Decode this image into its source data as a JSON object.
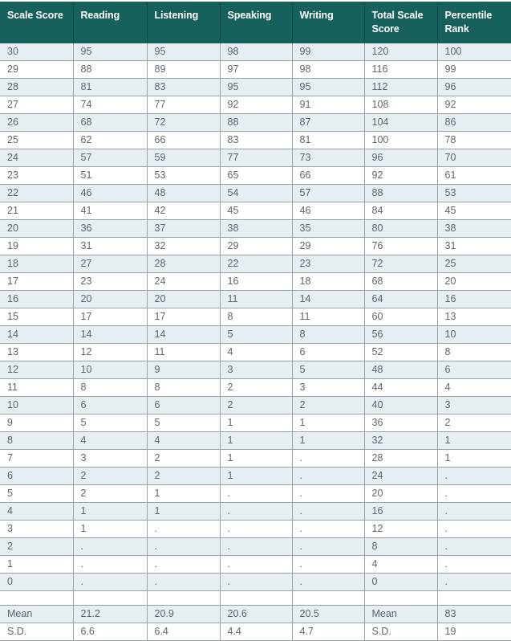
{
  "table": {
    "columns": [
      "Scale Score",
      "Reading",
      "Listening",
      "Speaking",
      "Writing",
      "Total Scale Score",
      "Percentile Rank"
    ],
    "rows": [
      [
        "30",
        "95",
        "95",
        "98",
        "99",
        "120",
        "100"
      ],
      [
        "29",
        "88",
        "89",
        "97",
        "98",
        "116",
        "99"
      ],
      [
        "28",
        "81",
        "83",
        "95",
        "95",
        "112",
        "96"
      ],
      [
        "27",
        "74",
        "77",
        "92",
        "91",
        "108",
        "92"
      ],
      [
        "26",
        "68",
        "72",
        "88",
        "87",
        "104",
        "86"
      ],
      [
        "25",
        "62",
        "66",
        "83",
        "81",
        "100",
        "78"
      ],
      [
        "24",
        "57",
        "59",
        "77",
        "73",
        "96",
        "70"
      ],
      [
        "23",
        "51",
        "53",
        "65",
        "66",
        "92",
        "61"
      ],
      [
        "22",
        "46",
        "48",
        "54",
        "57",
        "88",
        "53"
      ],
      [
        "21",
        "41",
        "42",
        "45",
        "46",
        "84",
        "45"
      ],
      [
        "20",
        "36",
        "37",
        "38",
        "35",
        "80",
        "38"
      ],
      [
        "19",
        "31",
        "32",
        "29",
        "29",
        "76",
        "31"
      ],
      [
        "18",
        "27",
        "28",
        "22",
        "23",
        "72",
        "25"
      ],
      [
        "17",
        "23",
        "24",
        "16",
        "18",
        "68",
        "20"
      ],
      [
        "16",
        "20",
        "20",
        "11",
        "14",
        "64",
        "16"
      ],
      [
        "15",
        "17",
        "17",
        "8",
        "11",
        "60",
        "13"
      ],
      [
        "14",
        "14",
        "14",
        "5",
        "8",
        "56",
        "10"
      ],
      [
        "13",
        "12",
        "11",
        "4",
        "6",
        "52",
        "8"
      ],
      [
        "12",
        "10",
        "9",
        "3",
        "5",
        "48",
        "6"
      ],
      [
        "11",
        "8",
        "8",
        "2",
        "3",
        "44",
        "4"
      ],
      [
        "10",
        "6",
        "6",
        "2",
        "2",
        "40",
        "3"
      ],
      [
        "9",
        "5",
        "5",
        "1",
        "1",
        "36",
        "2"
      ],
      [
        "8",
        "4",
        "4",
        "1",
        "1",
        "32",
        "1"
      ],
      [
        "7",
        "3",
        "2",
        "1",
        ".",
        "28",
        "1"
      ],
      [
        "6",
        "2",
        "2",
        "1",
        ".",
        "24",
        "."
      ],
      [
        "5",
        "2",
        "1",
        ".",
        ".",
        "20",
        "."
      ],
      [
        "4",
        "1",
        "1",
        ".",
        ".",
        "16",
        "."
      ],
      [
        "3",
        "1",
        ".",
        ".",
        ".",
        "12",
        "."
      ],
      [
        "2",
        ".",
        ".",
        ".",
        ".",
        "8",
        "."
      ],
      [
        "1",
        ".",
        ".",
        ".",
        ".",
        "4",
        "."
      ],
      [
        "0",
        ".",
        ".",
        ".",
        ".",
        "0",
        "."
      ]
    ],
    "spacer_row": [
      "",
      "",
      "",
      "",
      "",
      "",
      ""
    ],
    "summary_rows": [
      [
        "Mean",
        "21.2",
        "20.9",
        "20.6",
        "20.5",
        "Mean",
        "83"
      ],
      [
        "S.D.",
        "6.6",
        "6.4",
        "4.4",
        "4.7",
        "S.D.",
        "19"
      ]
    ]
  },
  "colors": {
    "header_background": "#16605e",
    "header_text": "#ffffff",
    "row_shade": "#e6eef2",
    "row_plain": "#ffffff",
    "body_text": "#5b6670",
    "border": "#9aa3a8"
  }
}
